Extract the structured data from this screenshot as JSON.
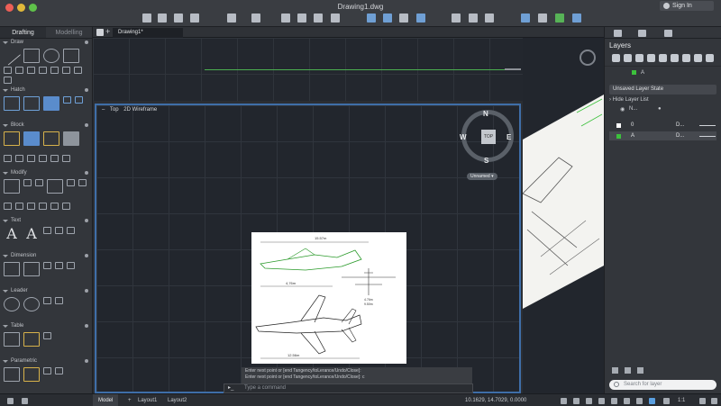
{
  "window": {
    "title": "Drawing1.dwg",
    "sign_in": "Sign In"
  },
  "left_panel": {
    "tabs": [
      "Drafting",
      "Modelling"
    ],
    "sections": [
      "Draw",
      "Hatch",
      "Block",
      "Modify",
      "Text",
      "Dimension",
      "Leader",
      "Table",
      "Parametric"
    ]
  },
  "document_tab": "Drawing1*",
  "viewport": {
    "controls": "–",
    "view": "Top",
    "visual_style": "2D Wireframe"
  },
  "viewcube": {
    "face": "TOP",
    "north": "N",
    "south": "S",
    "east": "E",
    "west": "W",
    "ucs_label": "Unnamed"
  },
  "drawing": {
    "dim_top": "15.57m",
    "dim_left": "4,76m",
    "dim_right_a": "4.76m",
    "dim_right_b": "9.50m",
    "dim_bottom": "12.56m"
  },
  "command": {
    "history_1": "Enter next point or [end Tangency/toLerance/Undo/Close]:",
    "history_2": "Enter next point or [end Tangency/toLerance/Undo/Close]: c",
    "prompt": "▸_",
    "placeholder": "Type a command"
  },
  "layers_panel": {
    "title": "Layers",
    "layer_state": "Unsaved Layer State",
    "hide_list": "Hide Layer List",
    "current_layer": "A",
    "columns": {
      "name": "N..."
    },
    "layers": [
      {
        "name": "0",
        "desc": "D...",
        "color": "#ffffff"
      },
      {
        "name": "A",
        "desc": "D...",
        "color": "#3cc13c"
      }
    ],
    "search_placeholder": "Search for layer"
  },
  "status_bar": {
    "tabs": [
      "Model",
      "Layout1",
      "Layout2"
    ],
    "coordinates": "10.1629, 14.7029, 0.0000",
    "scale": "1:1"
  },
  "colors": {
    "accent": "#3f6ea8",
    "grid": "#22262d",
    "layer_green": "#3cc13c"
  }
}
